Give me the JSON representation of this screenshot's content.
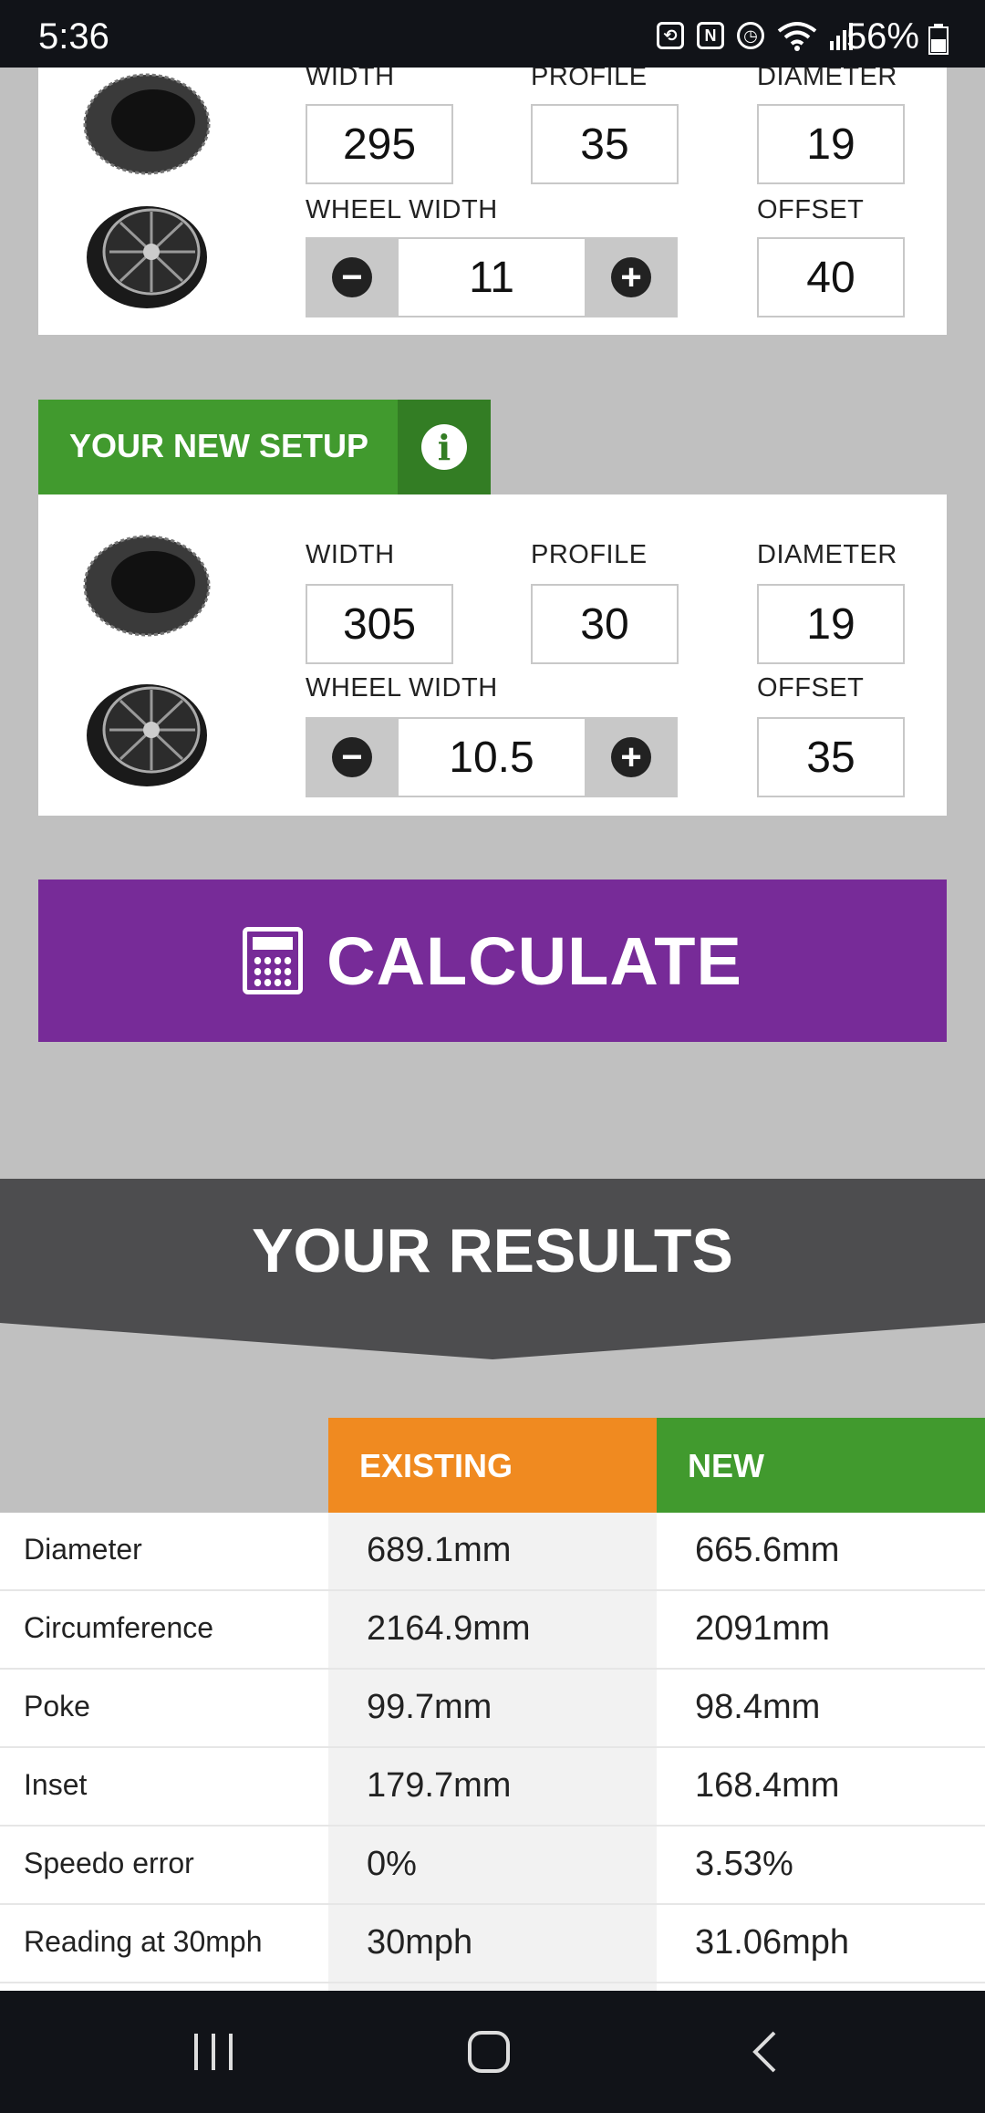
{
  "status_bar": {
    "time": "5:36",
    "battery_percent": "56%",
    "icons": [
      "battery-saver-icon",
      "nfc-icon",
      "alarm-icon",
      "wifi-icon",
      "signal-icon",
      "battery-icon"
    ]
  },
  "existing_setup": {
    "width_label": "WIDTH",
    "width": "295",
    "profile_label": "PROFILE",
    "profile": "35",
    "diameter_label": "DIAMETER",
    "diameter": "19",
    "wheel_width_label": "WHEEL WIDTH",
    "wheel_width": "11",
    "offset_label": "OFFSET",
    "offset": "40"
  },
  "new_setup": {
    "header": "YOUR NEW SETUP",
    "width_label": "WIDTH",
    "width": "305",
    "profile_label": "PROFILE",
    "profile": "30",
    "diameter_label": "DIAMETER",
    "diameter": "19",
    "wheel_width_label": "WHEEL WIDTH",
    "wheel_width": "10.5",
    "offset_label": "OFFSET",
    "offset": "35"
  },
  "calculate_label": "CALCULATE",
  "results": {
    "title": "YOUR RESULTS",
    "col_existing": "EXISTING",
    "col_new": "NEW",
    "rows": [
      {
        "label": "Diameter",
        "existing": "689.1mm",
        "new": "665.6mm"
      },
      {
        "label": "Circumference",
        "existing": "2164.9mm",
        "new": "2091mm"
      },
      {
        "label": "Poke",
        "existing": "99.7mm",
        "new": "98.4mm"
      },
      {
        "label": "Inset",
        "existing": "179.7mm",
        "new": "168.4mm"
      },
      {
        "label": "Speedo error",
        "existing": "0%",
        "new": "3.53%"
      },
      {
        "label": "Reading at 30mph",
        "existing": "30mph",
        "new": "31.06mph"
      }
    ]
  },
  "colors": {
    "green": "#419a2e",
    "orange": "#f08a20",
    "purple": "#772b98",
    "dark": "#4d4d4f"
  }
}
